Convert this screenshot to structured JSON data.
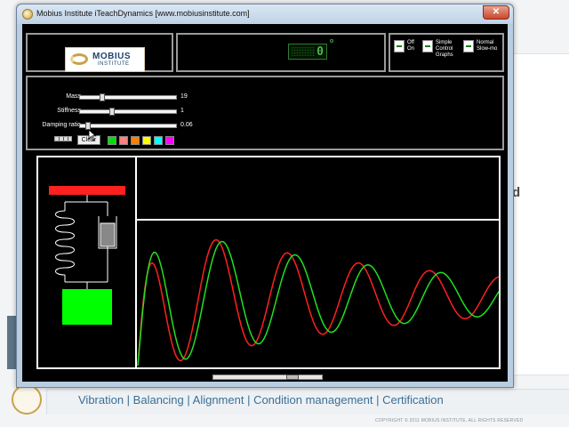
{
  "window": {
    "title": "Mobius Institute iTeachDynamics [www.mobiusinstitute.com]",
    "close_glyph": "✕"
  },
  "logo": {
    "line1": "MOBIUS",
    "line2": "INSTITUTE"
  },
  "lcd": {
    "value": "0"
  },
  "toggles": {
    "off_on": [
      "Off",
      "On"
    ],
    "graphs": [
      "Simple",
      "Control",
      "Graphs"
    ],
    "speed": [
      "Normal",
      "Slow-mo"
    ]
  },
  "sliders": [
    {
      "label": "Mass",
      "value": "19",
      "position": 0.22
    },
    {
      "label": "Stiffness",
      "value": "1",
      "position": 0.32
    },
    {
      "label": "Damping ratio",
      "value": "0.06",
      "position": 0.06
    }
  ],
  "controls": {
    "clear_label": "Clear"
  },
  "swatches": [
    "#00e000",
    "#ff8080",
    "#ff8000",
    "#ffff00",
    "#00ffff",
    "#ff00ff"
  ],
  "model": {
    "base_color": "#ff2020",
    "mass_color": "#00ff00"
  },
  "chart_data": {
    "type": "line",
    "series": [
      {
        "color": "#ff2020"
      },
      {
        "color": "#20e020"
      }
    ]
  },
  "footer": {
    "tagline": "Vibration | Balancing | Alignment | Condition management | Certification",
    "copyright": "COPYRIGHT © 2011 MOBIUS INSTITUTE.  ALL RIGHTS RESERVED"
  },
  "background": {
    "side_letter": "d"
  }
}
